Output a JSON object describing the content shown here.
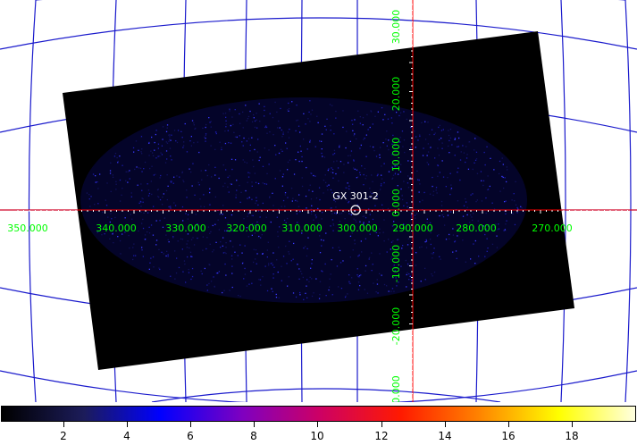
{
  "map": {
    "source": {
      "name": "GX 301-2"
    },
    "axis_color": "#00ff00",
    "grid_color": "#1a1acc",
    "crosshair_color": "#ff0000",
    "glon_labels": [
      "350.000",
      "340.000",
      "330.000",
      "320.000",
      "310.000",
      "300.000",
      "290.000",
      "280.000",
      "270.000"
    ],
    "glat_labels": [
      "30.000",
      "20.000",
      "10.000",
      "0.000",
      "-10.000",
      "-20.000",
      "0.000"
    ]
  },
  "colorbar": {
    "colors": [
      "#000000",
      "#1c1c5a",
      "#0000ff",
      "#7f00c0",
      "#cc0066",
      "#ff1a00",
      "#ff8000",
      "#ffff00",
      "#ffffe0"
    ],
    "ticks": [
      "2",
      "4",
      "6",
      "8",
      "10",
      "12",
      "14",
      "16",
      "18"
    ]
  }
}
